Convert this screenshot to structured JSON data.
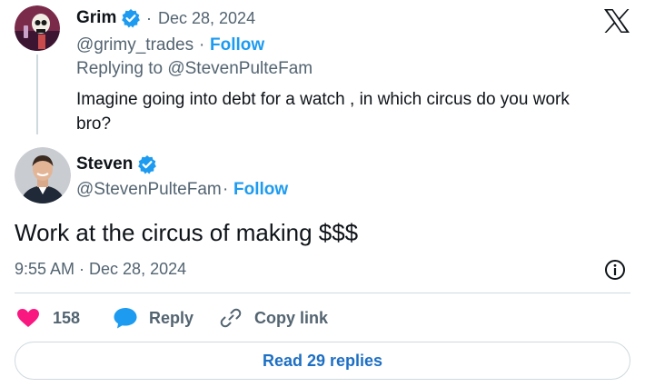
{
  "reply": {
    "author_name": "Grim",
    "separator": "·",
    "date": "Dec 28, 2024",
    "handle": "@grimy_trades",
    "follow_label": "Follow",
    "replying_to_prefix": "Replying to",
    "replying_to_handle": "@StevenPulteFam",
    "text": "Imagine going into debt for a watch , in which circus do you work bro?"
  },
  "main": {
    "author_name": "Steven",
    "handle": "@StevenPulteFam",
    "follow_label": "Follow",
    "text": "Work at the circus of making $$$",
    "timestamp": "9:55 AM · Dec 28, 2024"
  },
  "actions": {
    "like_count": "158",
    "reply_label": "Reply",
    "copy_link_label": "Copy link"
  },
  "read_replies_label": "Read 29 replies",
  "colors": {
    "accent": "#1d9bf0",
    "heart": "#f91880",
    "verified": "#1d9bf0",
    "muted": "#536471"
  },
  "icons": [
    "verified-badge-icon",
    "x-logo-icon",
    "info-icon",
    "heart-icon",
    "reply-bubble-icon",
    "link-icon"
  ]
}
